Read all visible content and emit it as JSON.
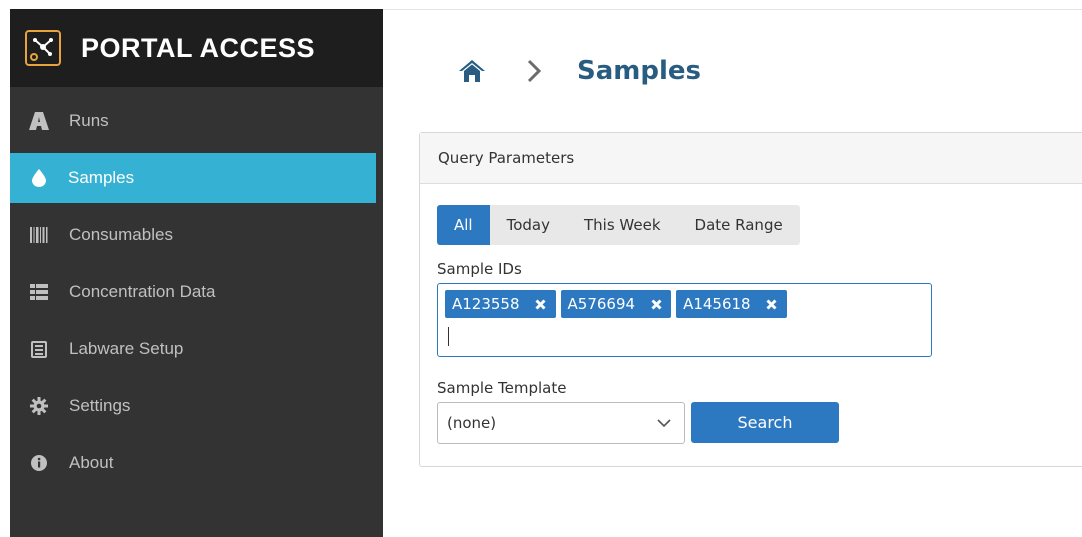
{
  "app": {
    "title": "PORTAL ACCESS"
  },
  "sidebar": {
    "items": [
      {
        "label": "Runs",
        "icon": "runs-icon"
      },
      {
        "label": "Samples",
        "icon": "droplet-icon",
        "active": true
      },
      {
        "label": "Consumables",
        "icon": "barcode-icon"
      },
      {
        "label": "Concentration Data",
        "icon": "table-icon"
      },
      {
        "label": "Labware Setup",
        "icon": "document-icon"
      },
      {
        "label": "Settings",
        "icon": "gear-icon"
      },
      {
        "label": "About",
        "icon": "info-icon"
      }
    ]
  },
  "breadcrumb": {
    "home": "home-icon",
    "separator": "chevron-right-icon",
    "current": "Samples"
  },
  "panel": {
    "title": "Query Parameters",
    "date_filters": [
      "All",
      "Today",
      "This Week",
      "Date Range"
    ],
    "date_filter_selected": "All",
    "sample_ids_label": "Sample IDs",
    "sample_ids": [
      "A123558",
      "A576694",
      "A145618"
    ],
    "template_label": "Sample Template",
    "template_value": "(none)",
    "search_label": "Search"
  },
  "colors": {
    "sidebar_bg": "#333333",
    "brand_bg": "#1e1e1e",
    "active_nav": "#35b1d3",
    "primary": "#2c78c1",
    "title_text": "#285c80",
    "logo_accent": "#e8a33c"
  }
}
